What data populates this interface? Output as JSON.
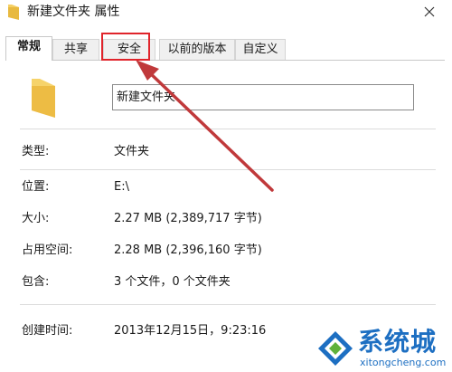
{
  "window": {
    "title": "新建文件夹 属性"
  },
  "tabs": [
    {
      "label": "常规",
      "active": true
    },
    {
      "label": "共享",
      "active": false
    },
    {
      "label": "安全",
      "active": false
    },
    {
      "label": "以前的版本",
      "active": false
    },
    {
      "label": "自定义",
      "active": false
    }
  ],
  "general": {
    "folder_name": "新建文件夹",
    "rows": [
      {
        "label": "类型:",
        "value": "文件夹"
      },
      {
        "label": "位置:",
        "value": "E:\\"
      },
      {
        "label": "大小:",
        "value": "2.27 MB (2,389,717 字节)"
      },
      {
        "label": "占用空间:",
        "value": "2.28 MB (2,396,160 字节)"
      },
      {
        "label": "包含:",
        "value": "3 个文件，0 个文件夹"
      },
      {
        "label": "创建时间:",
        "value": "2013年12月15日，9:23:16"
      }
    ]
  },
  "annotation": {
    "highlight_color": "#e0242b",
    "arrow_color": "#c0393b",
    "target_tab": "安全"
  },
  "watermark": {
    "text": "系统城",
    "url": "xitongcheng.com",
    "color": "#1d6fc2"
  },
  "icons": {
    "title": "folder-icon",
    "close": "close-icon",
    "large": "folder-large-icon"
  }
}
